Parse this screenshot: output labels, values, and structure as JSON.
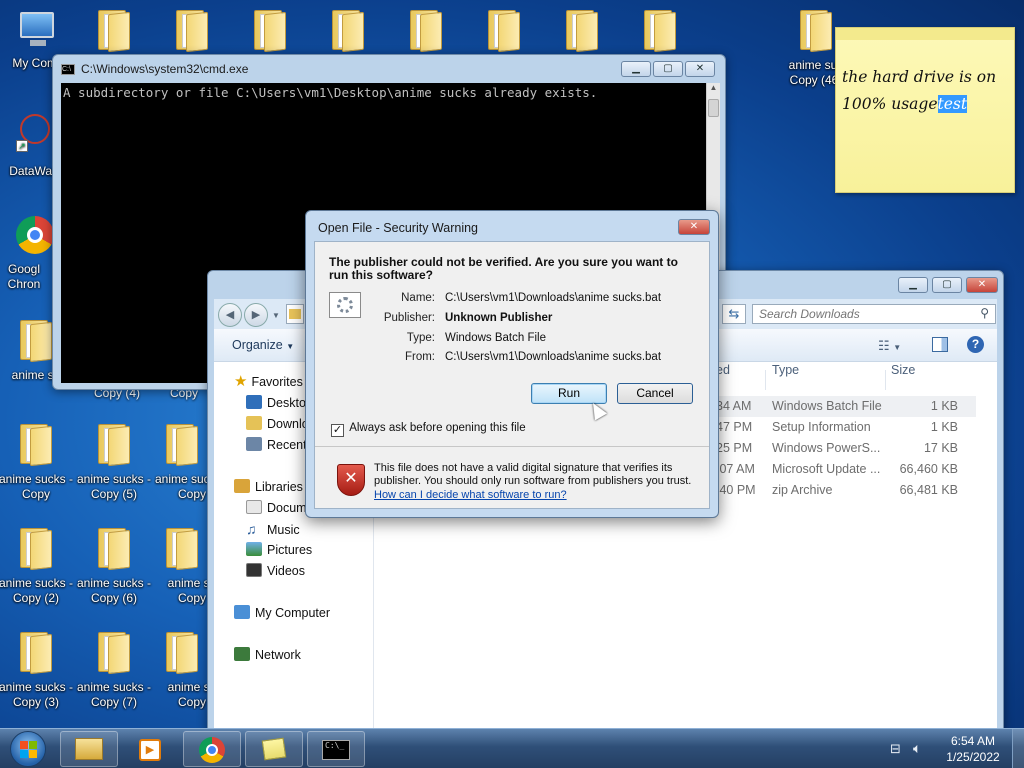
{
  "desktop": {
    "icons": [
      {
        "label": "My Comp"
      },
      {
        "label": "DataWag"
      },
      {
        "label": "Googl Chron"
      },
      {
        "label": "anime su"
      },
      {
        "label": "anime sucks - Copy"
      },
      {
        "label": "anime sucks - Copy (2)"
      },
      {
        "label": "anime sucks - Copy (3)"
      },
      {
        "label": "anime sucks - Copy (5)"
      },
      {
        "label": "anime sucks - Copy (6)"
      },
      {
        "label": "anime sucks - Copy (7)"
      },
      {
        "label": "anime suc Copy (46)"
      },
      {
        "label": "Copy (4)"
      },
      {
        "label": "Copy"
      },
      {
        "label": "anime sucks - Copy"
      },
      {
        "label": "anime su Copy"
      },
      {
        "label": "anime su Copy"
      }
    ]
  },
  "sticky_note": {
    "text_before": "the hard drive is on 100% usage",
    "text_selected": "test"
  },
  "cmd": {
    "title": "C:\\Windows\\system32\\cmd.exe",
    "output": "A subdirectory or file C:\\Users\\vm1\\Desktop\\anime sucks already exists."
  },
  "explorer": {
    "search_placeholder": "Search Downloads",
    "organize_label": "Organize",
    "nav": {
      "favorites": "Favorites",
      "desktop": "Desktop",
      "downloads": "Downlo",
      "recent": "Recent",
      "libraries": "Libraries",
      "documents": "Docum",
      "music": "Music",
      "pictures": "Pictures",
      "videos": "Videos",
      "my_computer": "My Computer",
      "network": "Network"
    },
    "columns": {
      "date_fragment": "ed",
      "type": "Type",
      "size": "Size"
    },
    "rows": [
      {
        "time": "34 AM",
        "type": "Windows Batch File",
        "size": "1 KB"
      },
      {
        "time": "47 PM",
        "type": "Setup Information",
        "size": "1 KB"
      },
      {
        "time": "25 PM",
        "type": "Windows PowerS...",
        "size": "17 KB"
      },
      {
        "time": ":07 AM",
        "type": "Microsoft Update ...",
        "size": "66,460 KB"
      },
      {
        "time": ":40 PM",
        "type": "zip Archive",
        "size": "66,481 KB"
      }
    ]
  },
  "dialog": {
    "title": "Open File - Security Warning",
    "heading": "The publisher could not be verified.  Are you sure you want to run this software?",
    "fields": {
      "name_label": "Name:",
      "name_value": "C:\\Users\\vm1\\Downloads\\anime sucks.bat",
      "publisher_label": "Publisher:",
      "publisher_value": "Unknown Publisher",
      "type_label": "Type:",
      "type_value": "Windows Batch File",
      "from_label": "From:",
      "from_value": "C:\\Users\\vm1\\Downloads\\anime sucks.bat"
    },
    "run_label": "Run",
    "cancel_label": "Cancel",
    "checkbox_label": "Always ask before opening this file",
    "checkbox_checked": true,
    "warning_text": "This file does not have a valid digital signature that verifies its publisher.  You should only run software from publishers you trust.",
    "help_link": "How can I decide what software to run?"
  },
  "taskbar": {
    "time": "6:54 AM",
    "date": "1/25/2022"
  }
}
